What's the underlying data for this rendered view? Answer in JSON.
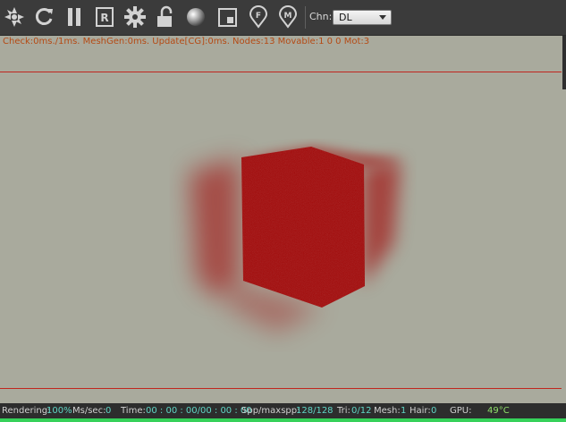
{
  "toolbar": {
    "icons": [
      "clapper-icon",
      "reload-icon",
      "pause-icon",
      "r-box-icon",
      "gear-icon",
      "unlock-icon",
      "sphere-icon",
      "region-icon",
      "focus-pin-icon",
      "material-pin-icon"
    ],
    "r_label": "R",
    "f_label": "F",
    "m_label": "M",
    "chn_label": "Chn:",
    "chn_value": "DL"
  },
  "status_line": "Check:0ms./1ms. MeshGen:0ms. Update[CG]:0ms. Nodes:13 Movable:1  0 0 Mot:3",
  "footer": {
    "rendering_label": "Rendering:",
    "rendering_value": "100%",
    "mssec_label": "Ms/sec:",
    "mssec_value": "0",
    "time_label": "Time:",
    "time_value": "00 : 00 : 00/00 : 00 : 00",
    "spp_label": "Spp/maxspp:",
    "spp_value": "128/128",
    "tri_label": "Tri:",
    "tri_value": "0/12",
    "mesh_label": "Mesh:",
    "mesh_value": "1",
    "hair_label": "Hair:",
    "hair_value": "0",
    "gpu_label": "GPU:",
    "gpu_temp": "49°C"
  },
  "colors": {
    "viewport_bg": "#a9aa9d",
    "cube": "#a10000",
    "status_text": "#b54a14",
    "value_text": "#5fd6c6",
    "progress_green": "#36d15a"
  }
}
